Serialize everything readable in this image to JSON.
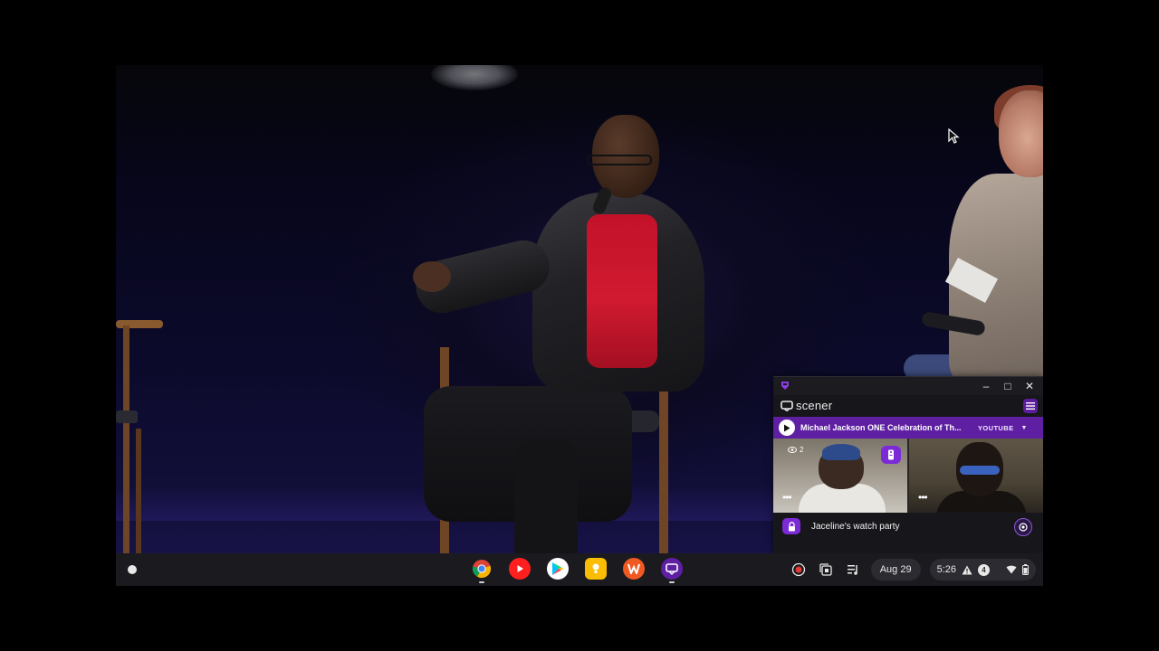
{
  "scener": {
    "logo_text": "scener",
    "now_playing_title": "Michael Jackson ONE Celebration of Th...",
    "source_label": "YOUTUBE",
    "viewer_count": "2",
    "room_name": "Jaceline's watch party",
    "camera_menu": "•••",
    "window_controls": {
      "minimize": "–",
      "maximize": "□",
      "close": "✕"
    }
  },
  "shelf": {
    "date": "Aug 29",
    "time": "5:26",
    "notification_count": "4",
    "apps": [
      "chrome",
      "youtube",
      "play-store",
      "keep",
      "wps-office",
      "scener"
    ]
  },
  "colors": {
    "scener_accent": "#5e1fa3",
    "scener_badge": "#7b2bd6",
    "shelf_bg": "#1b1b1f"
  }
}
